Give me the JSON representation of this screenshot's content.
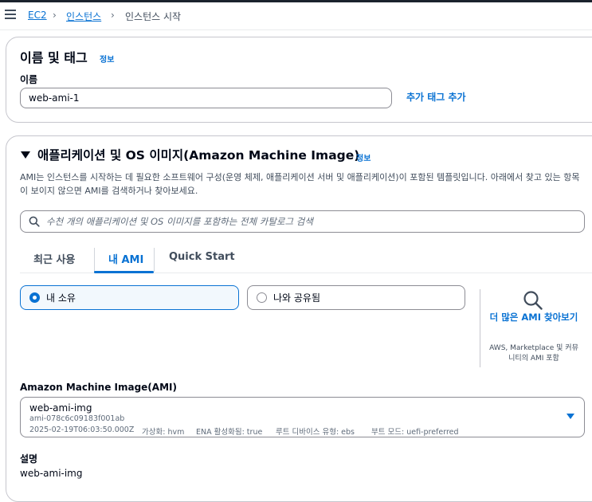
{
  "breadcrumb": [
    "EC2",
    "인스턴스",
    "인스턴스 시작"
  ],
  "name_tags": {
    "title": "이름 및 태그",
    "info": "정보",
    "name_label": "이름",
    "name_value": "web-ami-1",
    "add_tags": "추가 태그 추가"
  },
  "ami_section": {
    "title": "애플리케이션 및 OS 이미지(Amazon Machine Image)",
    "info": "정보",
    "description": "AMI는 인스턴스를 시작하는 데 필요한 소프트웨어 구성(운영 체제, 애플리케이션 서버 및 애플리케이션)이 포함된 템플릿입니다. 아래에서 찾고 있는 항목이 보이지 않으면 AMI를 검색하거나 찾아보세요.",
    "search_placeholder": "수천 개의 애플리케이션 및 OS 이미지를 포함하는 전체 카탈로그 검색",
    "tabs": [
      "최근 사용",
      "내 AMI",
      "Quick Start"
    ],
    "active_tab": "내 AMI",
    "owner_options": [
      "내 소유",
      "나와 공유됨"
    ],
    "selected_owner": "내 소유",
    "browse_more": "더 많은 AMI 찾아보기",
    "browse_sub": "AWS, Marketplace 및 커뮤니티의 AMI 포함",
    "ami_label": "Amazon Machine Image(AMI)",
    "selected_ami": {
      "name": "web-ami-img",
      "id": "ami-078c6c09183f001ab",
      "date": "2025-02-19T06:03:50.000Z",
      "virtualization": "가상화: hvm",
      "ena": "ENA 활성화됨: true",
      "root_device": "루트 디바이스 유형: ebs",
      "boot_mode": "부트 모드: uefi-preferred"
    },
    "description_label": "설명",
    "description_value": "web-ami-img"
  },
  "colors": {
    "accent": "#0972d3",
    "text": "#000716",
    "border": "#8c8c94"
  },
  "icons": [
    "menu-icon",
    "chevron-right-icon",
    "search-icon",
    "magnifier-icon",
    "caret-down-icon",
    "collapse-triangle-icon"
  ]
}
